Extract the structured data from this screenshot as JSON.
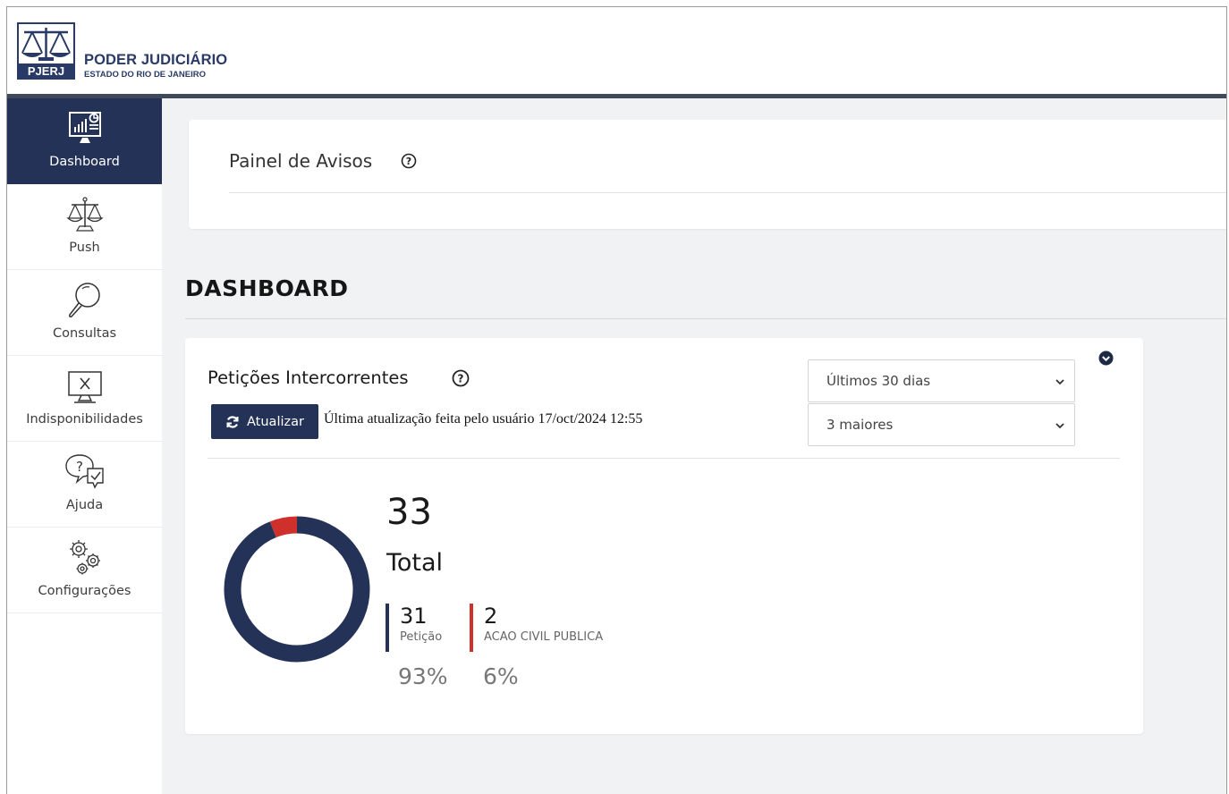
{
  "header": {
    "logo_text": "PJERJ",
    "title": "PODER JUDICIÁRIO",
    "subtitle": "ESTADO DO RIO DE JANEIRO"
  },
  "sidebar": {
    "items": [
      {
        "label": "Dashboard",
        "icon": "dashboard-icon",
        "active": true
      },
      {
        "label": "Push",
        "icon": "scales-icon"
      },
      {
        "label": "Consultas",
        "icon": "magnifier-icon"
      },
      {
        "label": "Indisponibilidades",
        "icon": "monitor-x-icon"
      },
      {
        "label": "Ajuda",
        "icon": "help-chat-icon"
      },
      {
        "label": "Configurações",
        "icon": "gears-icon"
      }
    ]
  },
  "avisos": {
    "title": "Painel de Avisos"
  },
  "dashboard": {
    "title": "DASHBOARD"
  },
  "peticoes": {
    "title": "Petições Intercorrentes",
    "refresh_label": "Atualizar",
    "last_update": "Última atualização feita pelo usuário 17/oct/2024 12:55",
    "period_select": "Últimos 30 dias",
    "top_select": "3 maiores",
    "total_value": "33",
    "total_label": "Total",
    "segments": [
      {
        "value": "31",
        "name": "Petição",
        "percent": "93%",
        "color": "#253258",
        "count": 31
      },
      {
        "value": "2",
        "name": "ACAO CIVIL PUBLICA",
        "percent": "6%",
        "color": "#d0302c",
        "count": 2
      }
    ]
  },
  "colors": {
    "primary": "#253258",
    "accent_red": "#d0302c",
    "page_bg": "#f1f2f4"
  }
}
